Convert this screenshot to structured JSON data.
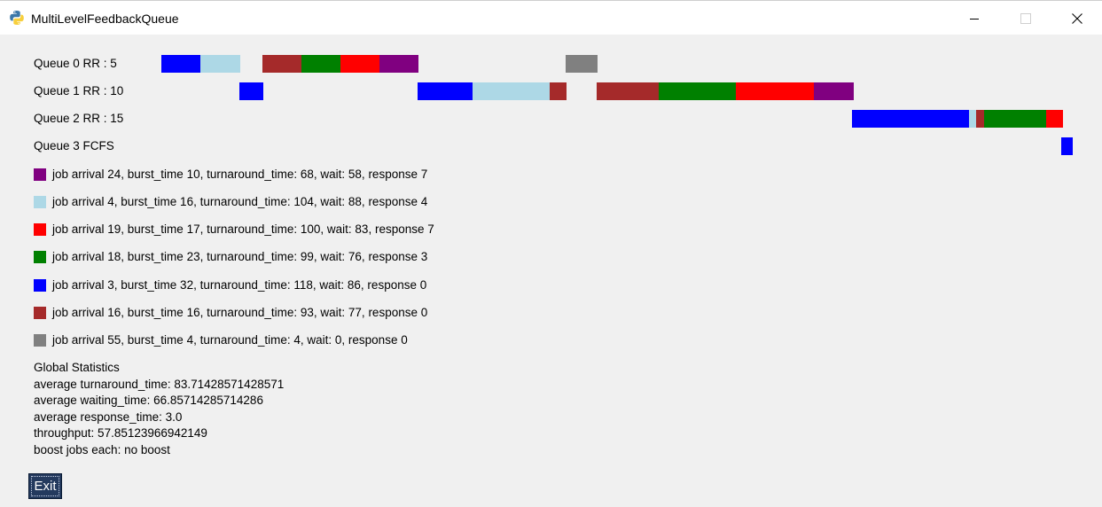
{
  "window": {
    "title": "MultiLevelFeedbackQueue",
    "app_icon": "python-icon",
    "controls": [
      "minimize-icon",
      "maximize-icon",
      "close-icon"
    ]
  },
  "colors": {
    "purple": "#800080",
    "lightblue": "#add8e6",
    "red": "#ff0000",
    "green": "#008000",
    "blue": "#0000ff",
    "brown": "#a52a2a",
    "gray": "#808080"
  },
  "queues": [
    {
      "label": "Queue 0 RR : 5"
    },
    {
      "label": "Queue 1 RR : 10"
    },
    {
      "label": "Queue 2 RR : 15"
    },
    {
      "label": "Queue 3 FCFS"
    }
  ],
  "jobs": [
    {
      "color": "#800080",
      "text": "job arrival 24, burst_time 10, turnaround_time: 68, wait: 58, response 7"
    },
    {
      "color": "#add8e6",
      "text": "job arrival 4, burst_time 16, turnaround_time: 104, wait: 88, response 4"
    },
    {
      "color": "#ff0000",
      "text": "job arrival 19, burst_time 17, turnaround_time: 100, wait: 83, response 7"
    },
    {
      "color": "#008000",
      "text": "job arrival 18, burst_time 23, turnaround_time: 99, wait: 76, response 3"
    },
    {
      "color": "#0000ff",
      "text": "job arrival 3, burst_time 32, turnaround_time: 118, wait: 86, response 0"
    },
    {
      "color": "#a52a2a",
      "text": "job arrival 16, burst_time 16, turnaround_time: 93, wait: 77, response 0"
    },
    {
      "color": "#808080",
      "text": "job arrival 55, burst_time 4, turnaround_time: 4, wait: 0, response 0"
    }
  ],
  "stats": {
    "heading": "Global Statistics",
    "avg_turnaround": "average turnaround_time: 83.71428571428571",
    "avg_waiting": "average waiting_time: 66.85714285714286",
    "avg_response": "average response_time: 3.0",
    "throughput": "throughput: 57.85123966942149",
    "boost": "boost jobs each: no boost"
  },
  "exit_label": "Exit"
}
